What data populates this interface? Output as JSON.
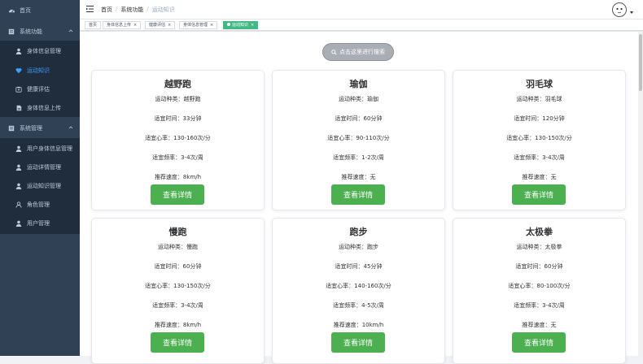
{
  "sidebar": {
    "items": [
      {
        "label": "首页",
        "icon": "dashboard-icon"
      },
      {
        "label": "系统功能",
        "icon": "system-icon"
      },
      {
        "label": "身体信息管理",
        "icon": "user-icon"
      },
      {
        "label": "运动知识",
        "icon": "heart-icon"
      },
      {
        "label": "健康评估",
        "icon": "assess-icon"
      },
      {
        "label": "身体信息上传",
        "icon": "document-icon"
      },
      {
        "label": "系统管理",
        "icon": "system-icon"
      },
      {
        "label": "用户身体信息管理",
        "icon": "user-icon"
      },
      {
        "label": "运动详情管理",
        "icon": "user-icon"
      },
      {
        "label": "运动知识管理",
        "icon": "user-icon"
      },
      {
        "label": "角色管理",
        "icon": "peoples-icon"
      },
      {
        "label": "用户管理",
        "icon": "user-icon"
      }
    ]
  },
  "breadcrumb": [
    "首页",
    "系统功能",
    "运动知识"
  ],
  "tags": [
    {
      "label": "首页",
      "active": false
    },
    {
      "label": "身体信息上传",
      "active": false
    },
    {
      "label": "健康评估",
      "active": false
    },
    {
      "label": "身体信息管理",
      "active": false
    },
    {
      "label": "运动知识",
      "active": true
    }
  ],
  "search_button": "点击这里进行搜索",
  "cards": [
    {
      "title": "越野跑",
      "rows": [
        "运动种类：越野跑",
        "适宜时间：33分钟",
        "适宜心率：130-160次/分",
        "适宜频率：3-4次/周",
        "推荐速度：8km/h"
      ],
      "button": "查看详情"
    },
    {
      "title": "瑜伽",
      "rows": [
        "运动种类：瑜伽",
        "适宜时间：60分钟",
        "适宜心率：90-110次/分",
        "适宜频率：1-2次/周",
        "推荐速度：无"
      ],
      "button": "查看详情"
    },
    {
      "title": "羽毛球",
      "rows": [
        "运动种类：羽毛球",
        "适宜时间：120分钟",
        "适宜心率：130-150次/分",
        "适宜频率：3-4次/周",
        "推荐速度：无"
      ],
      "button": "查看详情"
    },
    {
      "title": "慢跑",
      "rows": [
        "运动种类：慢跑",
        "适宜时间：60分钟",
        "适宜心率：130-150次/分",
        "适宜频率：3-4次/周",
        "推荐速度：8km/h"
      ],
      "button": "查看详情"
    },
    {
      "title": "跑步",
      "rows": [
        "运动种类：跑步",
        "适宜时间：45分钟",
        "适宜心率：140-160次/分",
        "适宜频率：4-5次/周",
        "推荐速度：10km/h"
      ],
      "button": "查看详情"
    },
    {
      "title": "太极拳",
      "rows": [
        "运动种类：太极拳",
        "适宜时间：60分钟",
        "适宜心率：80-100次/分",
        "适宜频率：3-4次/周",
        "推荐速度：无"
      ],
      "button": "查看详情"
    }
  ],
  "colors": {
    "sidebar_bg": "#304156",
    "sidebar_active": "#409eff",
    "tag_active": "#42b983",
    "button": "#4caf50"
  }
}
